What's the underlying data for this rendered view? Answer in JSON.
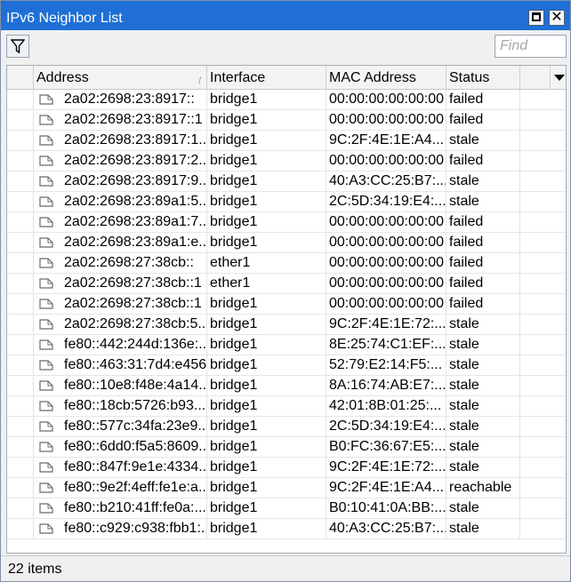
{
  "window": {
    "title": "IPv6 Neighbor List"
  },
  "toolbar": {
    "find_placeholder": "Find"
  },
  "table": {
    "columns": [
      "Address",
      "Interface",
      "MAC Address",
      "Status"
    ],
    "rows": [
      {
        "address": "2a02:2698:23:8917::",
        "interface": "bridge1",
        "mac": "00:00:00:00:00:00",
        "status": "failed"
      },
      {
        "address": "2a02:2698:23:8917::1",
        "interface": "bridge1",
        "mac": "00:00:00:00:00:00",
        "status": "failed"
      },
      {
        "address": "2a02:2698:23:8917:1...",
        "interface": "bridge1",
        "mac": "9C:2F:4E:1E:A4...",
        "status": "stale"
      },
      {
        "address": "2a02:2698:23:8917:2...",
        "interface": "bridge1",
        "mac": "00:00:00:00:00:00",
        "status": "failed"
      },
      {
        "address": "2a02:2698:23:8917:9...",
        "interface": "bridge1",
        "mac": "40:A3:CC:25:B7:...",
        "status": "stale"
      },
      {
        "address": "2a02:2698:23:89a1:5...",
        "interface": "bridge1",
        "mac": "2C:5D:34:19:E4:...",
        "status": "stale"
      },
      {
        "address": "2a02:2698:23:89a1:7...",
        "interface": "bridge1",
        "mac": "00:00:00:00:00:00",
        "status": "failed"
      },
      {
        "address": "2a02:2698:23:89a1:e...",
        "interface": "bridge1",
        "mac": "00:00:00:00:00:00",
        "status": "failed"
      },
      {
        "address": "2a02:2698:27:38cb::",
        "interface": "ether1",
        "mac": "00:00:00:00:00:00",
        "status": "failed"
      },
      {
        "address": "2a02:2698:27:38cb::1",
        "interface": "ether1",
        "mac": "00:00:00:00:00:00",
        "status": "failed"
      },
      {
        "address": "2a02:2698:27:38cb::1",
        "interface": "bridge1",
        "mac": "00:00:00:00:00:00",
        "status": "failed"
      },
      {
        "address": "2a02:2698:27:38cb:5...",
        "interface": "bridge1",
        "mac": "9C:2F:4E:1E:72:...",
        "status": "stale"
      },
      {
        "address": "fe80::442:244d:136e:...",
        "interface": "bridge1",
        "mac": "8E:25:74:C1:EF:...",
        "status": "stale"
      },
      {
        "address": "fe80::463:31:7d4:e456",
        "interface": "bridge1",
        "mac": "52:79:E2:14:F5:...",
        "status": "stale"
      },
      {
        "address": "fe80::10e8:f48e:4a14...",
        "interface": "bridge1",
        "mac": "8A:16:74:AB:E7:...",
        "status": "stale"
      },
      {
        "address": "fe80::18cb:5726:b93...",
        "interface": "bridge1",
        "mac": "42:01:8B:01:25:...",
        "status": "stale"
      },
      {
        "address": "fe80::577c:34fa:23e9...",
        "interface": "bridge1",
        "mac": "2C:5D:34:19:E4:...",
        "status": "stale"
      },
      {
        "address": "fe80::6dd0:f5a5:8609...",
        "interface": "bridge1",
        "mac": "B0:FC:36:67:E5:...",
        "status": "stale"
      },
      {
        "address": "fe80::847f:9e1e:4334...",
        "interface": "bridge1",
        "mac": "9C:2F:4E:1E:72:...",
        "status": "stale"
      },
      {
        "address": "fe80::9e2f:4eff:fe1e:a...",
        "interface": "bridge1",
        "mac": "9C:2F:4E:1E:A4...",
        "status": "reachable"
      },
      {
        "address": "fe80::b210:41ff:fe0a:...",
        "interface": "bridge1",
        "mac": "B0:10:41:0A:BB:...",
        "status": "stale"
      },
      {
        "address": "fe80::c929:c938:fbb1:...",
        "interface": "bridge1",
        "mac": "40:A3:CC:25:B7:...",
        "status": "stale"
      }
    ]
  },
  "statusbar": {
    "count": "22 items"
  },
  "colors": {
    "titlebar": "#1f6fd6",
    "background": "#f0f0f0",
    "grid_border": "#a5acb5"
  }
}
